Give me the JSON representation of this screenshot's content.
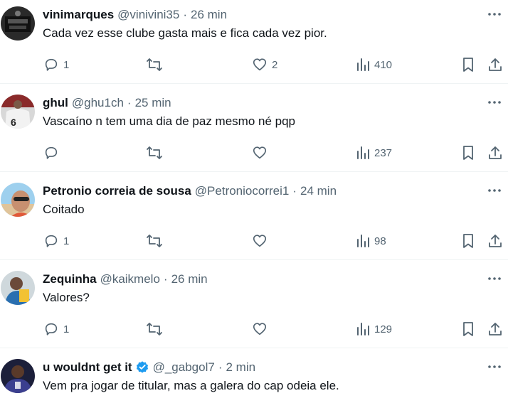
{
  "tweets": [
    {
      "name": "vinimarques",
      "handle": "@vinivini35",
      "time": "26 min",
      "verified": false,
      "text": "Cada vez esse clube gasta mais e fica cada vez pior.",
      "replies": "1",
      "retweets": "",
      "likes": "2",
      "views": "410"
    },
    {
      "name": "ghul",
      "handle": "@ghu1ch",
      "time": "25 min",
      "verified": false,
      "text": "Vascaíno n tem uma dia de paz mesmo né pqp",
      "replies": "",
      "retweets": "",
      "likes": "",
      "views": "237"
    },
    {
      "name": "Petronio correia de sousa",
      "handle": "@Petroniocorrei1",
      "time": "24 min",
      "verified": false,
      "text": "Coitado",
      "replies": "1",
      "retweets": "",
      "likes": "",
      "views": "98"
    },
    {
      "name": "Zequinha",
      "handle": "@kaikmelo",
      "time": "26 min",
      "verified": false,
      "text": "Valores?",
      "replies": "1",
      "retweets": "",
      "likes": "",
      "views": "129"
    },
    {
      "name": "u wouldnt get it",
      "handle": "@_gabgol7",
      "time": "2 min",
      "verified": true,
      "text": "Vem pra jogar de titular, mas a galera do cap odeia ele.",
      "replies": "",
      "retweets": "",
      "likes": "",
      "views": ""
    }
  ],
  "separator": "·",
  "icons": {
    "reply": "reply-icon",
    "retweet": "retweet-icon",
    "like": "heart-icon",
    "views": "views-icon",
    "bookmark": "bookmark-icon",
    "share": "share-icon",
    "more": "more-icon",
    "verified": "verified-icon"
  },
  "colors": {
    "text": "#0f1419",
    "secondary": "#536471",
    "verified": "#1d9bf0",
    "divider": "#eff3f4"
  }
}
